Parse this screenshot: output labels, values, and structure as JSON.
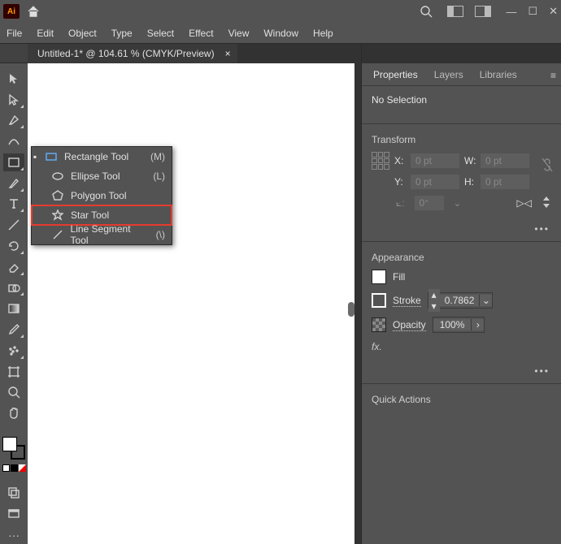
{
  "titlebar": {
    "app_badge": "Ai"
  },
  "menu": {
    "items": [
      "File",
      "Edit",
      "Object",
      "Type",
      "Select",
      "Effect",
      "View",
      "Window",
      "Help"
    ]
  },
  "document": {
    "tab_label": "Untitled-1* @ 104.61 % (CMYK/Preview)",
    "close": "×"
  },
  "tools": {
    "names": [
      "selection",
      "direct-selection",
      "pen",
      "curvature",
      "shape",
      "line",
      "type",
      "paintbrush",
      "rotate",
      "eraser",
      "shape-builder",
      "gradient",
      "eyedropper",
      "navigate",
      "artboard",
      "zoom",
      "hand",
      "more-tools",
      "fill-stroke",
      "draw-modes",
      "screen-mode",
      "overflow"
    ]
  },
  "flyout": {
    "items": [
      {
        "label": "Rectangle Tool",
        "shortcut": "(M)",
        "selected": true
      },
      {
        "label": "Ellipse Tool",
        "shortcut": "(L)"
      },
      {
        "label": "Polygon Tool",
        "shortcut": ""
      },
      {
        "label": "Star Tool",
        "shortcut": "",
        "highlight": true
      },
      {
        "label": "Line Segment Tool",
        "shortcut": "(\\)"
      }
    ]
  },
  "panel": {
    "tabs": [
      "Properties",
      "Layers",
      "Libraries"
    ],
    "no_selection": "No Selection",
    "transform": {
      "title": "Transform",
      "x_label": "X:",
      "y_label": "Y:",
      "w_label": "W:",
      "h_label": "H:",
      "x": "0 pt",
      "y": "0 pt",
      "w": "0 pt",
      "h": "0 pt",
      "angle": "0°"
    },
    "appearance": {
      "title": "Appearance",
      "fill": "Fill",
      "stroke": "Stroke",
      "stroke_val": "0.7862",
      "opacity": "Opacity",
      "opacity_val": "100%",
      "fx": "fx."
    },
    "quick_actions": "Quick Actions"
  }
}
